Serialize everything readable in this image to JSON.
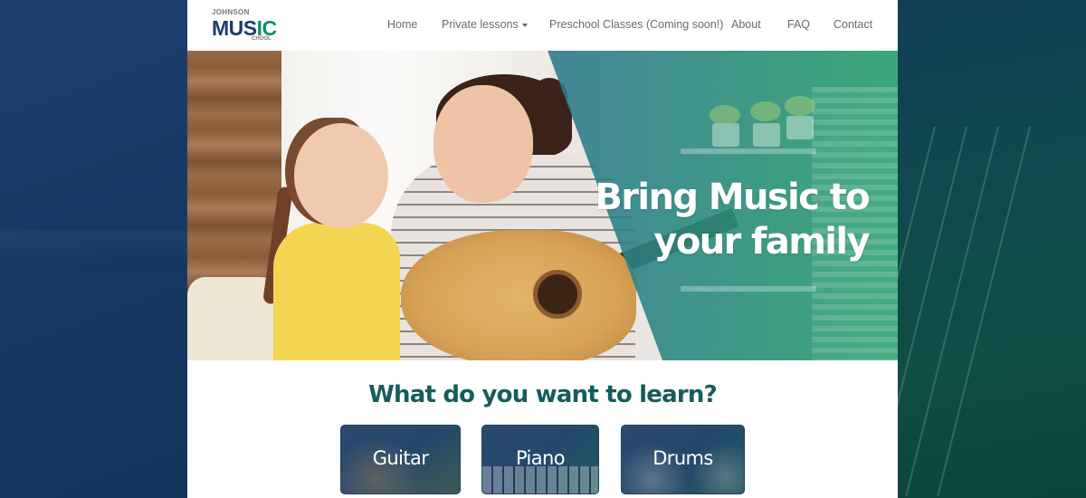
{
  "logo": {
    "top_text": "JOHNSON",
    "main_text_a": "MU",
    "main_text_b": "S",
    "main_text_c": "IC",
    "bottom_text": "CHOOL"
  },
  "nav": {
    "items": [
      {
        "label": "Home"
      },
      {
        "label": "Private lessons",
        "has_dropdown": true
      },
      {
        "label": "Preschool Classes (Coming soon!)"
      },
      {
        "label": "About"
      },
      {
        "label": "FAQ"
      },
      {
        "label": "Contact"
      }
    ]
  },
  "hero": {
    "title_line1": "Bring Music to",
    "title_line2": "your family"
  },
  "learn": {
    "title": "What do you want to learn?",
    "cards": [
      {
        "label": "Guitar"
      },
      {
        "label": "Piano"
      },
      {
        "label": "Drums"
      }
    ]
  },
  "colors": {
    "brand_navy": "#1a3c6d",
    "brand_green": "#158a72",
    "heading_teal": "#155d5d"
  }
}
